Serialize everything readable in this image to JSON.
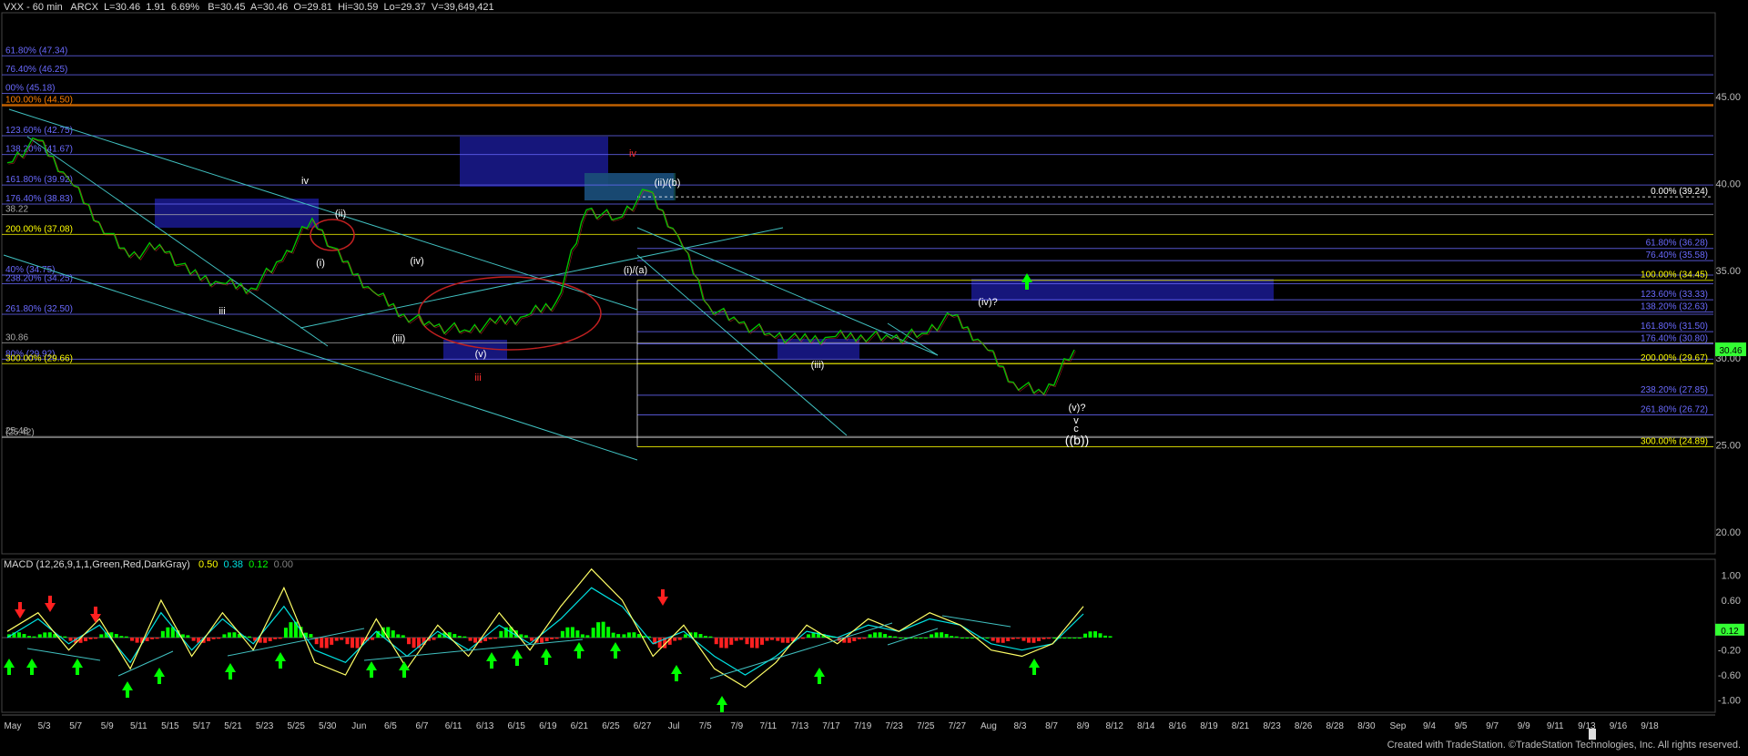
{
  "header": {
    "symbol": "VXX - 60 min",
    "exchange": "ARCX",
    "last": "L=30.46",
    "change": "1.91",
    "pct": "6.69%",
    "bid": "B=30.45",
    "ask": "A=30.46",
    "open": "O=29.81",
    "high": "Hi=30.59",
    "low": "Lo=29.37",
    "volume": "V=39,649,421"
  },
  "macd_header": {
    "label": "MACD (12,26,9,1,1,Green,Red,DarkGray)",
    "v1": "0.50",
    "v2": "0.38",
    "v3": "0.12",
    "v4": "0.00",
    "c1": "#ffff00",
    "c2": "#00e0e0",
    "c3": "#00ff00",
    "c4": "#808080"
  },
  "credit": "Created with TradeStation. ©TradeStation Technologies, Inc. All rights reserved.",
  "colors": {
    "background": "#000000",
    "up_bar": "#00c000",
    "down_bar": "#ff3030",
    "fib_blue": "#6a6aff",
    "fib_yellow": "#ffff00",
    "fib_orange": "#ff8000",
    "trendline": "#40c0c0",
    "box": "#1a1a90",
    "macd_line": "#ffff66",
    "signal_line": "#00e0e0",
    "hist_up": "#00ff00",
    "hist_down": "#ff2020",
    "arrow_up": "#00ff00",
    "arrow_down": "#ff2020",
    "last_tag": "#33ff33"
  },
  "chart_data": [
    {
      "type": "line",
      "title": "",
      "price_axis": {
        "ylim": [
          18.5,
          49.5
        ],
        "ticks": [
          "45.00",
          "40.00",
          "35.00",
          "30.00",
          "25.00",
          "20.00"
        ],
        "last_price": "30.46"
      },
      "x_tick_labels": [
        "May",
        "5/3",
        "5/7",
        "5/9",
        "5/11",
        "5/15",
        "5/17",
        "5/21",
        "5/23",
        "5/25",
        "5/30",
        "Jun",
        "6/5",
        "6/7",
        "6/11",
        "6/13",
        "6/15",
        "6/19",
        "6/21",
        "6/25",
        "6/27",
        "Jul",
        "7/5",
        "7/9",
        "7/11",
        "7/13",
        "7/17",
        "7/19",
        "7/23",
        "7/25",
        "7/27",
        "Aug",
        "8/3",
        "8/7",
        "8/9",
        "8/12",
        "8/14",
        "8/16",
        "8/19",
        "8/21",
        "8/23",
        "8/26",
        "8/28",
        "8/30",
        "Sep",
        "9/4",
        "9/5",
        "9/7",
        "9/9",
        "9/11",
        "9/13",
        "9/16",
        "9/18"
      ],
      "series": [
        {
          "x": [
            "5/1",
            "5/3",
            "5/7",
            "5/9",
            "5/11",
            "5/15",
            "5/17",
            "5/21",
            "5/23",
            "5/25",
            "5/30",
            "Jun",
            "6/5",
            "6/7",
            "6/11",
            "6/13",
            "6/15",
            "6/19",
            "6/21",
            "6/25",
            "6/27",
            "Jul",
            "7/5",
            "7/9",
            "7/11",
            "7/13",
            "7/17",
            "7/19",
            "7/23",
            "7/25",
            "7/27",
            "Aug",
            "8/3",
            "8/7",
            "8/9",
            "8/10"
          ],
          "values": [
            41.2,
            42.5,
            40.3,
            37.8,
            35.8,
            36.5,
            34.8,
            34.3,
            34.0,
            35.6,
            38.0,
            35.5,
            33.8,
            32.5,
            31.8,
            31.6,
            32.0,
            32.4,
            33.2,
            38.5,
            38.0,
            39.6,
            37.0,
            33.0,
            32.0,
            31.4,
            31.0,
            31.2,
            31.3,
            31.1,
            31.4,
            32.4,
            30.8,
            28.6,
            27.9,
            30.46
          ]
        }
      ],
      "fib_levels_left": [
        {
          "label": "61.80% (47.34)",
          "value": 47.34,
          "color": "#6a6aff"
        },
        {
          "label": "76.40% (46.25)",
          "value": 46.25,
          "color": "#6a6aff"
        },
        {
          "label": "00% (45.18)",
          "value": 45.18,
          "color": "#6a6aff"
        },
        {
          "label": "100.00% (44.50)",
          "value": 44.5,
          "color": "#ff8000"
        },
        {
          "label": "123.60% (42.75)",
          "value": 42.75,
          "color": "#6a6aff"
        },
        {
          "label": "138.20% (41.67)",
          "value": 41.67,
          "color": "#6a6aff"
        },
        {
          "label": "161.80% (39.92)",
          "value": 39.92,
          "color": "#6a6aff"
        },
        {
          "label": "176.40% (38.83)",
          "value": 38.83,
          "color": "#6a6aff"
        },
        {
          "label": "38.22",
          "value": 38.22,
          "color": "#aaaaaa"
        },
        {
          "label": "200.00% (37.08)",
          "value": 37.08,
          "color": "#ffff00"
        },
        {
          "label": "40% (34.75)",
          "value": 34.75,
          "color": "#6a6aff"
        },
        {
          "label": "238.20% (34.25)",
          "value": 34.25,
          "color": "#6a6aff"
        },
        {
          "label": "261.80% (32.50)",
          "value": 32.5,
          "color": "#6a6aff"
        },
        {
          "label": "30.86",
          "value": 30.86,
          "color": "#aaaaaa"
        },
        {
          "label": "80% (29.92)",
          "value": 29.92,
          "color": "#6a6aff"
        },
        {
          "label": "300.00% (29.66)",
          "value": 29.66,
          "color": "#ffff00"
        },
        {
          "label": "25.48",
          "value": 25.48,
          "color": "#aaaaaa"
        },
        {
          "label": "(25.42)",
          "value": 25.42,
          "color": "#aaaaaa"
        }
      ],
      "fib_levels_right": [
        {
          "label": "0.00% (39.24)",
          "value": 39.24,
          "color": "#ffffff"
        },
        {
          "label": "61.80% (36.28)",
          "value": 36.28,
          "color": "#6a6aff"
        },
        {
          "label": "76.40% (35.58)",
          "value": 35.58,
          "color": "#6a6aff"
        },
        {
          "label": "100.00% (34.45)",
          "value": 34.45,
          "color": "#ffff00"
        },
        {
          "label": "123.60% (33.33)",
          "value": 33.33,
          "color": "#6a6aff"
        },
        {
          "label": "138.20% (32.63)",
          "value": 32.63,
          "color": "#6a6aff"
        },
        {
          "label": "161.80% (31.50)",
          "value": 31.5,
          "color": "#6a6aff"
        },
        {
          "label": "176.40% (30.80)",
          "value": 30.8,
          "color": "#6a6aff"
        },
        {
          "label": "200.00% (29.67)",
          "value": 29.67,
          "color": "#ffff00"
        },
        {
          "label": "238.20% (27.85)",
          "value": 27.85,
          "color": "#6a6aff"
        },
        {
          "label": "261.80% (26.72)",
          "value": 26.72,
          "color": "#6a6aff"
        },
        {
          "label": "300.00% (24.89)",
          "value": 24.89,
          "color": "#ffff00"
        }
      ],
      "wave_labels": [
        {
          "text": "iv",
          "color": "#ffffff"
        },
        {
          "text": "(ii)",
          "color": "#ffffff"
        },
        {
          "text": "(i)",
          "color": "#ffffff"
        },
        {
          "text": "(iv)",
          "color": "#ffffff"
        },
        {
          "text": "iii",
          "color": "#ffffff"
        },
        {
          "text": "(iii)",
          "color": "#ffffff"
        },
        {
          "text": "(v)",
          "color": "#ffffff"
        },
        {
          "text": "iii",
          "color": "#ff3030"
        },
        {
          "text": "iv",
          "color": "#ff3030"
        },
        {
          "text": "(ii)/(b)",
          "color": "#ffffff"
        },
        {
          "text": "(i)/(a)",
          "color": "#ffffff"
        },
        {
          "text": "(iii)",
          "color": "#ffffff"
        },
        {
          "text": "(iv)?",
          "color": "#ffffff"
        },
        {
          "text": "(v)?",
          "color": "#ffffff"
        },
        {
          "text": "v",
          "color": "#ffffff"
        },
        {
          "text": "c",
          "color": "#ffffff"
        },
        {
          "text": "((b))",
          "color": "#ffffff"
        }
      ]
    },
    {
      "type": "line",
      "title": "MACD (12,26,9,1,1,Green,Red,DarkGray)",
      "ylim": [
        -1.2,
        1.2
      ],
      "y_tick_labels": [
        "1.00",
        "0.60",
        "0.12",
        "-0.20",
        "-0.60",
        "-1.00"
      ],
      "series": [
        {
          "name": "MACD",
          "values": [
            0.1,
            0.4,
            -0.2,
            0.3,
            -0.5,
            0.6,
            -0.3,
            0.4,
            -0.2,
            0.8,
            -0.4,
            -0.6,
            0.3,
            -0.5,
            0.2,
            -0.3,
            0.4,
            -0.2,
            0.5,
            1.1,
            0.6,
            -0.3,
            0.2,
            -0.5,
            -0.8,
            -0.4,
            0.2,
            -0.1,
            0.3,
            0.1,
            0.4,
            0.2,
            -0.2,
            -0.3,
            -0.1,
            0.5
          ]
        },
        {
          "name": "Signal",
          "values": [
            0.0,
            0.3,
            -0.1,
            0.2,
            -0.4,
            0.4,
            -0.2,
            0.3,
            -0.1,
            0.5,
            -0.2,
            -0.4,
            0.1,
            -0.3,
            0.1,
            -0.2,
            0.2,
            -0.1,
            0.3,
            0.8,
            0.5,
            -0.1,
            0.1,
            -0.3,
            -0.6,
            -0.3,
            0.1,
            0.0,
            0.2,
            0.1,
            0.3,
            0.2,
            -0.1,
            -0.2,
            -0.1,
            0.38
          ]
        }
      ]
    }
  ]
}
